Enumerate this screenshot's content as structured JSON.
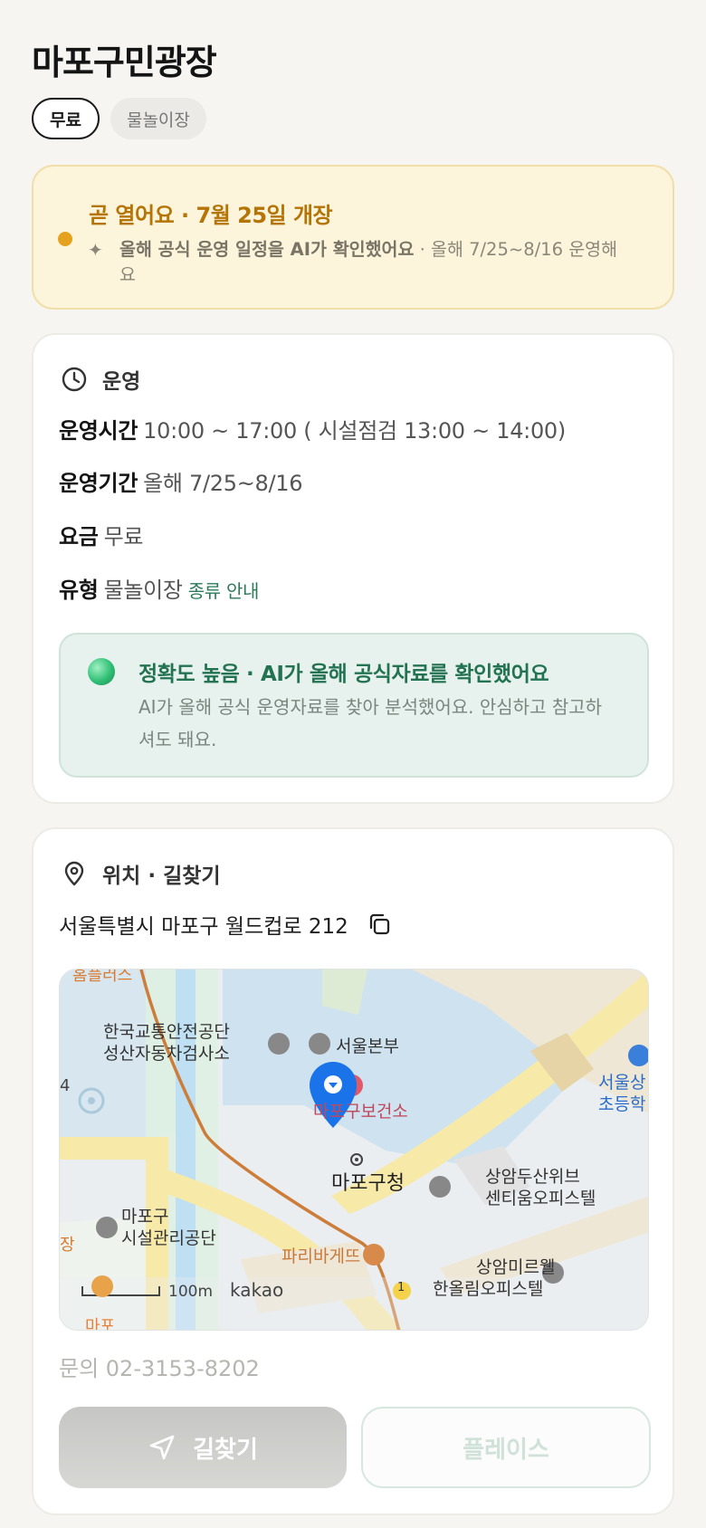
{
  "title": "마포구민광장",
  "chips": [
    {
      "label": "무료",
      "active": true
    },
    {
      "label": "물놀이장",
      "active": false
    }
  ],
  "notice": {
    "title": "곧 열어요 · 7월 25일 개장",
    "body_bold": "올해 공식 운영 일정을 AI가 확인했어요",
    "body_rest": " · 올해 7/25~8/16 운영해요"
  },
  "operation": {
    "heading": "운영",
    "hours_label": "운영시간",
    "hours_value": "10:00 ~ 17:00 ( 시설점검 13:00 ~ 14:00)",
    "period_label": "운영기간",
    "period_value": "올해 7/25~8/16",
    "fee_label": "요금",
    "fee_value": "무료",
    "type_label": "유형",
    "type_value": "물놀이장",
    "type_link": "종류 안내"
  },
  "accuracy": {
    "title": "정확도 높음 · AI가 올해 공식자료를 확인했어요",
    "body": "AI가 올해 공식 운영자료를 찾아 분석했어요. 안심하고 참고하셔도 돼요."
  },
  "location": {
    "heading": "위치 · 길찾기",
    "address": "서울특별시 마포구 월드컵로 212",
    "contact": "문의 02-3153-8202",
    "directions_label": "길찾기",
    "place_label": "플레이스"
  },
  "map": {
    "labels": {
      "traffic": "한국교통안전공단",
      "traffic2": "성산자동차검사소",
      "seoul_hq": "서울본부",
      "health": "마포구보건소",
      "office": "마포구청",
      "sangam1": "상암두산위브",
      "sangam2": "센티움오피스텔",
      "facility1": "마포구",
      "facility2": "시설관리공단",
      "bakery": "파리바게뜨",
      "mireu1": "상암미르웰",
      "mireu2": "한올림오피스텔",
      "school1": "서울상",
      "school2": "초등학",
      "top_left": "홈플러스",
      "scale": "100m",
      "brand": "kakao",
      "route": "1",
      "left_num": "4",
      "left_char": "장",
      "bottom_left": "마포"
    },
    "colors": {
      "pin": "#1a73e8",
      "road": "#f7e9a8",
      "water": "#cde3f2"
    }
  }
}
